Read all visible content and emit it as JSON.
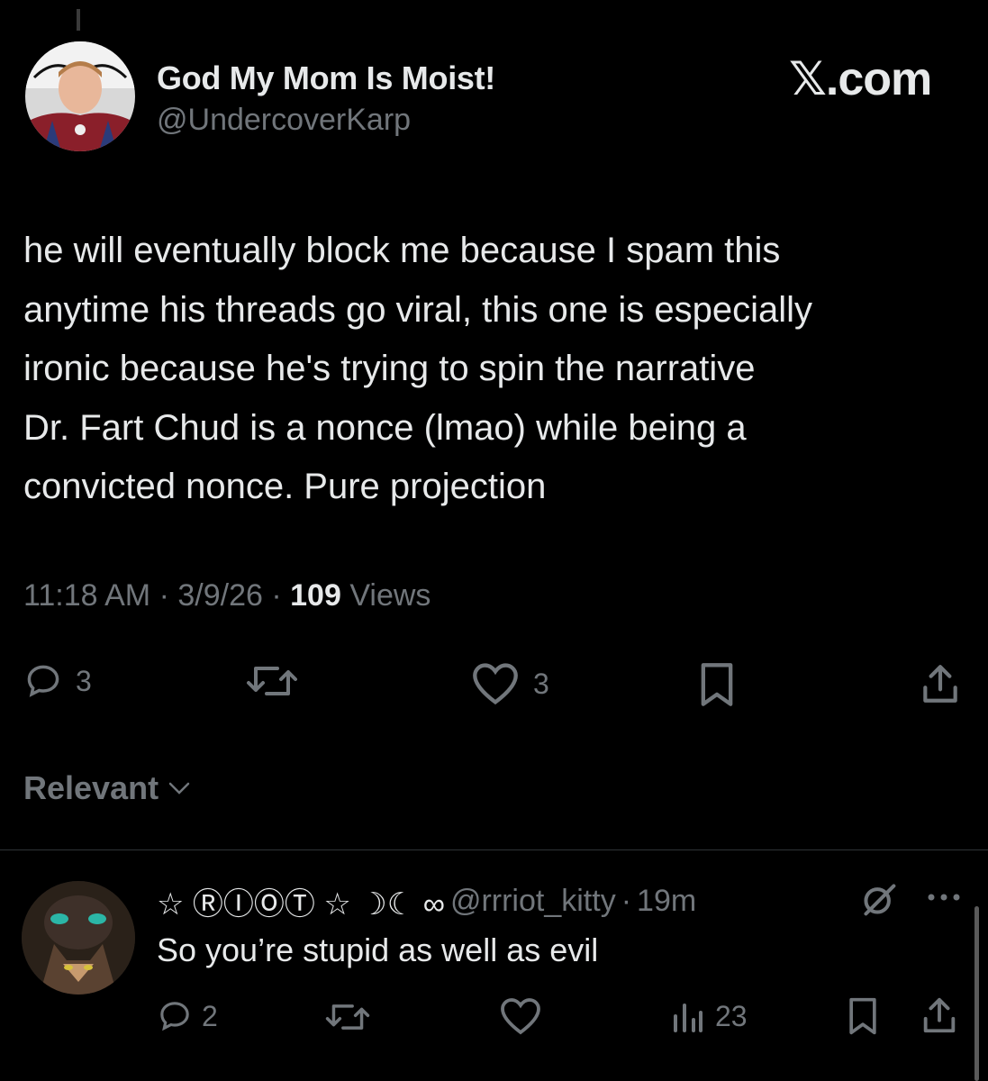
{
  "post": {
    "author": {
      "display_name": "God My Mom Is Moist!",
      "handle": "@UndercoverKarp"
    },
    "brand": "𝕏.com",
    "text": "he will eventually block me because I spam this\nanytime his threads go viral, this one is especially\nironic because he's trying to spin the narrative\nDr. Fart Chud is a nonce (lmao) while being a\nconvicted nonce. Pure projection",
    "time": "11:18 AM",
    "date": "3/9/26",
    "separator": "·",
    "views_count": "109",
    "views_label": "Views",
    "actions": {
      "replies": "3",
      "likes": "3"
    }
  },
  "sort": {
    "label": "Relevant"
  },
  "reply": {
    "display_name": "☆ ⓇⒾⓄⓉ ☆ ☽☾ ∞",
    "handle": "@rrriot_kitty",
    "separator": "·",
    "time": "19m",
    "text": "So you’re stupid as well as evil",
    "actions": {
      "replies": "2",
      "views": "23"
    }
  },
  "colors": {
    "background": "#000000",
    "text": "#e7e9ea",
    "secondary": "#71767b",
    "divider": "#2f3336"
  }
}
